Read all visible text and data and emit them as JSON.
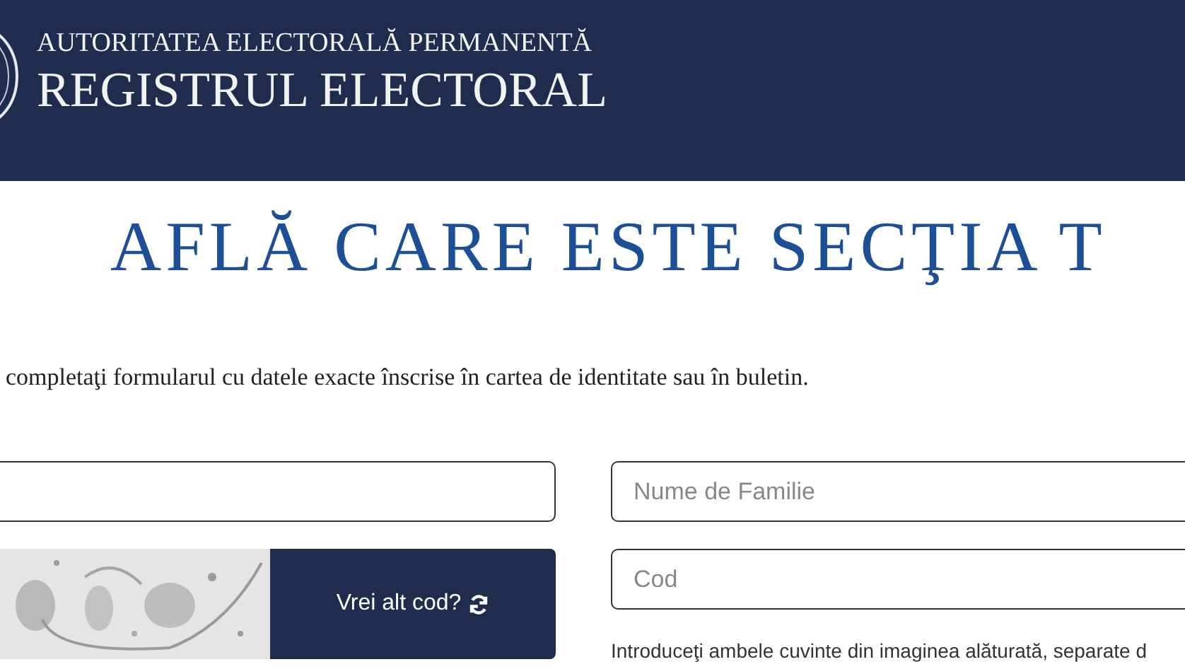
{
  "header": {
    "authority": "AUTORITATEA ELECTORALĂ PERMANENTĂ",
    "title": "REGISTRUL ELECTORAL"
  },
  "page_title": "AFLĂ CARE ESTE SECŢIA T",
  "instructions": "completaţi formularul cu datele exacte înscrise în cartea de identitate sau în buletin.",
  "form": {
    "last_name": {
      "placeholder": "Nume de Familie"
    },
    "captcha": {
      "kind": "picture",
      "refresh_button": "Vrei alt cod?"
    },
    "code": {
      "placeholder": "Cod"
    },
    "help": "Introduceţi ambele cuvinte din imaginea alăturată, separate d"
  }
}
